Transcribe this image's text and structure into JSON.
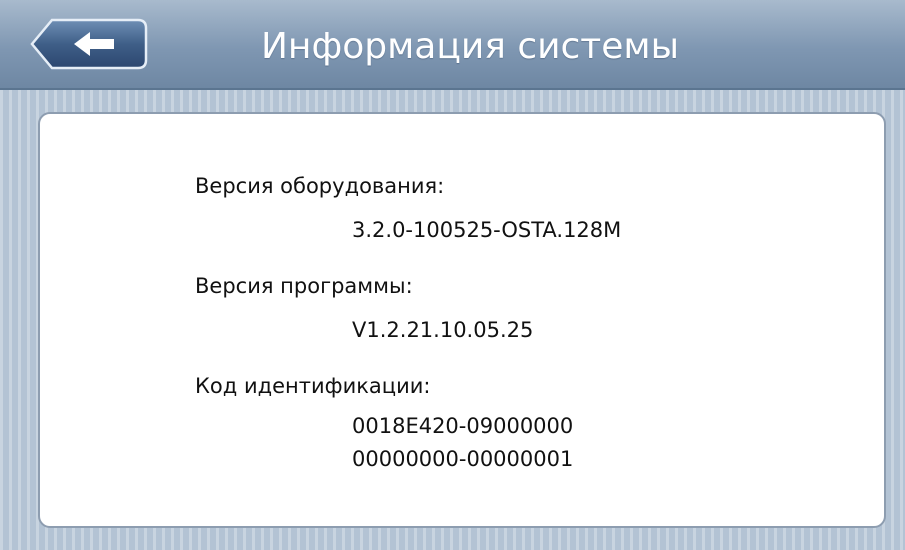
{
  "header": {
    "title": "Информация системы",
    "back_icon": "back-arrow-icon"
  },
  "info": {
    "hardware_label": "Версия оборудования:",
    "hardware_value": "3.2.0-100525-OSTA.128M",
    "software_label": "Версия программы:",
    "software_value": "V1.2.21.10.05.25",
    "id_label": "Код идентификации:",
    "id_value_line1": "0018E420-09000000",
    "id_value_line2": "00000000-00000001"
  },
  "colors": {
    "header_bar": "#7f97b2",
    "background": "#b3c3d4",
    "card": "#ffffff"
  }
}
